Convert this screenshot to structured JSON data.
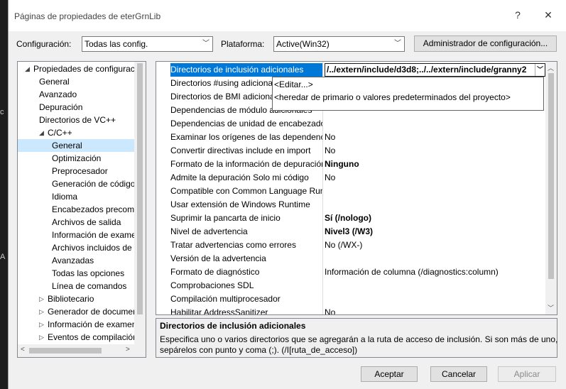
{
  "background": {
    "left_fragments": [
      "c",
      "A"
    ]
  },
  "window": {
    "title": "Páginas de propiedades de eterGrnLib",
    "help_glyph": "?",
    "close_glyph": "✕"
  },
  "toolbar": {
    "config_label": "Configuración:",
    "config_value": "Todas las config.",
    "platform_label": "Plataforma:",
    "platform_value": "Active(Win32)",
    "config_manager_label": "Administrador de configuración..."
  },
  "tree": {
    "items": [
      {
        "label": "Propiedades de configuración",
        "twisty": "◢",
        "expanded": true
      },
      {
        "label": "General"
      },
      {
        "label": "Avanzado"
      },
      {
        "label": "Depuración"
      },
      {
        "label": "Directorios de VC++"
      },
      {
        "label": "C/C++",
        "twisty": "◢",
        "expanded": true
      },
      {
        "label": "General",
        "selected": true
      },
      {
        "label": "Optimización"
      },
      {
        "label": "Preprocesador"
      },
      {
        "label": "Generación de código"
      },
      {
        "label": "Idioma"
      },
      {
        "label": "Encabezados precompilados"
      },
      {
        "label": "Archivos de salida"
      },
      {
        "label": "Información de examen"
      },
      {
        "label": "Archivos incluidos de origen"
      },
      {
        "label": "Avanzadas"
      },
      {
        "label": "Todas las opciones"
      },
      {
        "label": "Línea de comandos"
      },
      {
        "label": "Bibliotecario",
        "twisty": "▷"
      },
      {
        "label": "Generador de documentos XML",
        "twisty": "▷"
      },
      {
        "label": "Información de examen",
        "twisty": "▷"
      },
      {
        "label": "Eventos de compilación",
        "twisty": "▷"
      }
    ]
  },
  "grid": {
    "rows": [
      {
        "name": "Directorios de inclusión adicionales",
        "value": "/../extern/include/d3d8;../../extern/include/granny2",
        "selected": true
      },
      {
        "name": "Directorios #using adicionales",
        "value": ""
      },
      {
        "name": "Directorios de BMI adicionales",
        "value": ""
      },
      {
        "name": "Dependencias de módulo adicionales",
        "value": ""
      },
      {
        "name": "Dependencias de unidad de encabezado adicionales",
        "value": ""
      },
      {
        "name": "Examinar los orígenes de las dependencias",
        "value": "No"
      },
      {
        "name": "Convertir directivas include en import",
        "value": "No"
      },
      {
        "name": "Formato de la información de depuración",
        "value": "Ninguno",
        "bold": true
      },
      {
        "name": "Admite la depuración Solo mi código",
        "value": "No"
      },
      {
        "name": "Compatible con Common Language Runtime",
        "value": ""
      },
      {
        "name": "Usar extensión de Windows Runtime",
        "value": ""
      },
      {
        "name": "Suprimir la pancarta de inicio",
        "value": "Sí (/nologo)",
        "bold": true
      },
      {
        "name": "Nivel de advertencia",
        "value": "Nivel3 (/W3)",
        "bold": true
      },
      {
        "name": "Tratar advertencias como errores",
        "value": "No (/WX-)"
      },
      {
        "name": "Versión de la advertencia",
        "value": ""
      },
      {
        "name": "Formato de diagnóstico",
        "value": "Información de columna (/diagnostics:column)"
      },
      {
        "name": "Comprobaciones SDL",
        "value": ""
      },
      {
        "name": "Compilación multiprocesador",
        "value": ""
      },
      {
        "name": "Habilitar AddressSanitizer",
        "value": "No"
      }
    ],
    "dropdown_options": [
      "<Editar...>",
      "<heredar de primario o valores predeterminados del proyecto>"
    ]
  },
  "description": {
    "title": "Directorios de inclusión adicionales",
    "line1": "Especifica uno o varios directorios que se agregarán a la ruta de acceso de inclusión. Si son más de uno,",
    "line2": "sepárelos con punto y coma (;). (/I[ruta_de_acceso])"
  },
  "buttons": {
    "accept": "Aceptar",
    "cancel": "Cancelar",
    "apply": "Aplicar"
  }
}
